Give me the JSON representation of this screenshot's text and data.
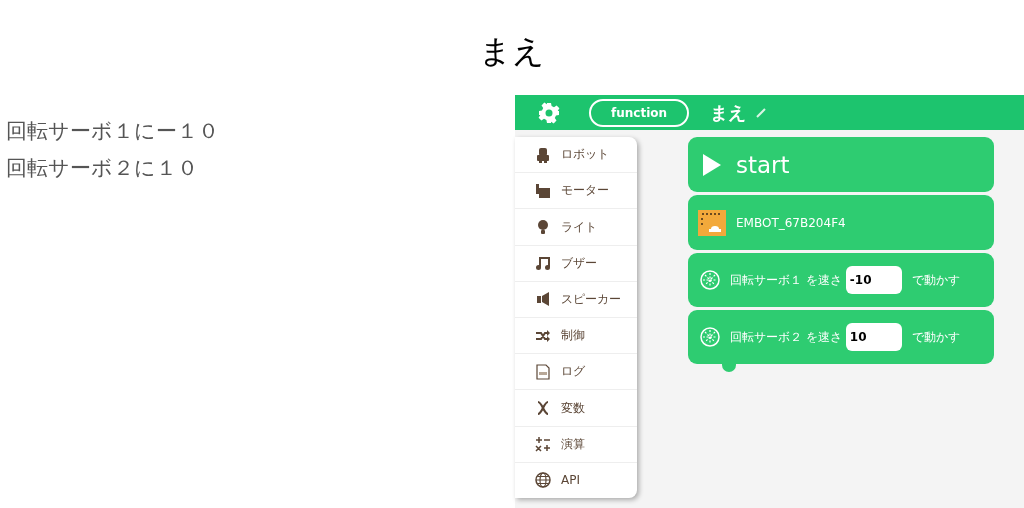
{
  "title": "まえ",
  "instructions": [
    "回転サーボ１にー１０",
    "回転サーボ２に１０"
  ],
  "toolbar": {
    "mode": "function",
    "name": "まえ"
  },
  "categories": [
    {
      "label": "ロボット"
    },
    {
      "label": "モーター"
    },
    {
      "label": "ライト"
    },
    {
      "label": "ブザー"
    },
    {
      "label": "スピーカー"
    },
    {
      "label": "制御"
    },
    {
      "label": "ログ"
    },
    {
      "label": "変数"
    },
    {
      "label": "演算"
    },
    {
      "label": "API"
    }
  ],
  "blocks": [
    {
      "kind": "start",
      "label": "start"
    },
    {
      "kind": "device",
      "label": "EMBOT_67B204F4"
    },
    {
      "kind": "servo",
      "label": "回転サーボ１ を速さ",
      "value": "-10",
      "suffix": "で動かす"
    },
    {
      "kind": "servo",
      "label": "回転サーボ２ を速さ",
      "value": "10",
      "suffix": "で動かす"
    }
  ]
}
